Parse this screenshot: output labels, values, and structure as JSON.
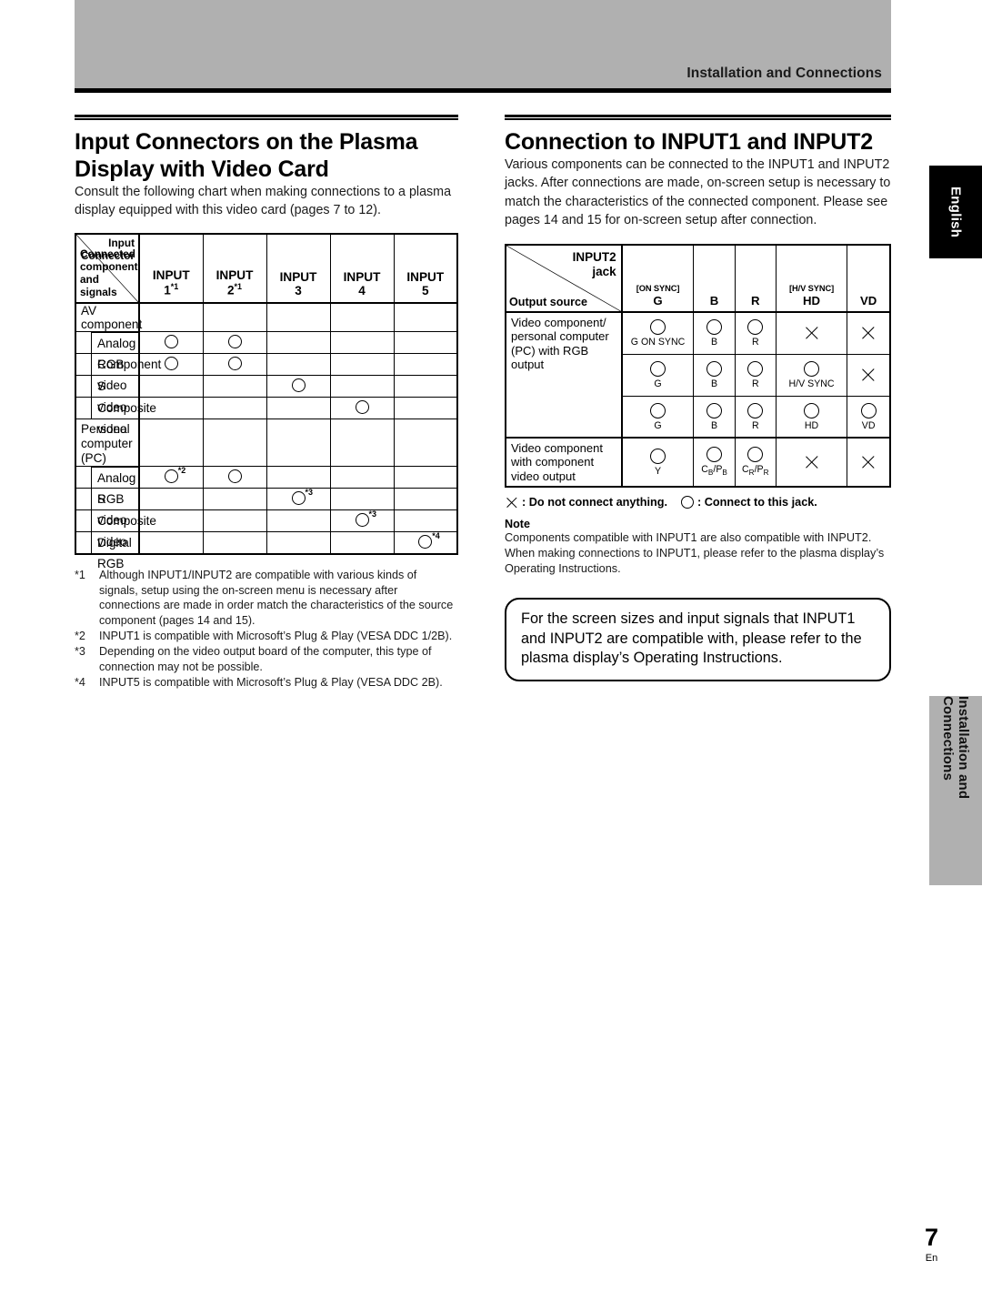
{
  "header": {
    "title": "Installation and Connections"
  },
  "left": {
    "heading": "Input Connectors on the Plasma Display with Video Card",
    "lead": "Consult the following chart when making connections to a plasma display equipped with this video card (pages 7 to 12).",
    "table": {
      "corner_top_right": "Input Connector",
      "corner_bottom_left": "Connected component and signals",
      "columns": [
        {
          "name": "INPUT",
          "num": "1",
          "note": "*1"
        },
        {
          "name": "INPUT",
          "num": "2",
          "note": "*1"
        },
        {
          "name": "INPUT",
          "num": "3",
          "note": ""
        },
        {
          "name": "INPUT",
          "num": "4",
          "note": ""
        },
        {
          "name": "INPUT",
          "num": "5",
          "note": ""
        }
      ],
      "rows": [
        {
          "label": "AV component",
          "type": "group",
          "marks": [
            "",
            "",
            "",
            "",
            ""
          ]
        },
        {
          "label": "Analog RGB",
          "type": "sub",
          "first": true,
          "marks": [
            "o",
            "o",
            "",
            "",
            ""
          ]
        },
        {
          "label": "Component video",
          "type": "sub",
          "marks": [
            "o",
            "o",
            "",
            "",
            ""
          ]
        },
        {
          "label": "S video",
          "type": "sub",
          "marks": [
            "",
            "",
            "o",
            "",
            ""
          ]
        },
        {
          "label": "Composite video",
          "type": "sub",
          "marks": [
            "",
            "",
            "",
            "o",
            ""
          ]
        },
        {
          "label": "Personal computer (PC)",
          "type": "group-tall",
          "marks": [
            "",
            "",
            "",
            "",
            ""
          ]
        },
        {
          "label": "Analog RGB",
          "type": "sub",
          "first": true,
          "marks": [
            "o*2",
            "o",
            "",
            "",
            ""
          ]
        },
        {
          "label": "S video",
          "type": "sub",
          "marks": [
            "",
            "",
            "o*3",
            "",
            ""
          ]
        },
        {
          "label": "Composite video",
          "type": "sub",
          "marks": [
            "",
            "",
            "",
            "o*3",
            ""
          ]
        },
        {
          "label": "Digital RGB",
          "type": "sub",
          "marks": [
            "",
            "",
            "",
            "",
            "o*4"
          ]
        }
      ]
    },
    "footnotes": [
      {
        "num": "*1",
        "text": "Although INPUT1/INPUT2 are compatible with various kinds of signals, setup using the on-screen menu is necessary after connections are made in order match the characteristics of the source component (pages 14 and 15)."
      },
      {
        "num": "*2",
        "text": "INPUT1 is compatible with Microsoft’s Plug & Play (VESA DDC 1/2B)."
      },
      {
        "num": "*3",
        "text": "Depending on the video output board of the computer, this type of connection may not be possible."
      },
      {
        "num": "*4",
        "text": "INPUT5 is compatible with Microsoft’s Plug & Play (VESA DDC 2B)."
      }
    ]
  },
  "right": {
    "heading": "Connection to INPUT1 and INPUT2",
    "lead": "Various components can be connected to the INPUT1 and INPUT2 jacks. After connections are made, on-screen setup is necessary to match the characteristics of the connected component. Please see pages 14 and 15 for on-screen setup after connection.",
    "table": {
      "corner_top_right": "INPUT2 jack",
      "corner_bottom_left": "Output source",
      "columns": [
        {
          "tag": "[ON SYNC]",
          "label": "G"
        },
        {
          "tag": "",
          "label": "B"
        },
        {
          "tag": "",
          "label": "R"
        },
        {
          "tag": "[H/V SYNC]",
          "label": "HD"
        },
        {
          "tag": "",
          "label": "VD"
        }
      ],
      "groups": [
        {
          "source": "Video component/ personal computer (PC) with RGB output",
          "rows": [
            [
              {
                "glyph": "o",
                "cap": "G ON SYNC"
              },
              {
                "glyph": "o",
                "cap": "B"
              },
              {
                "glyph": "o",
                "cap": "R"
              },
              {
                "glyph": "x",
                "cap": ""
              },
              {
                "glyph": "x",
                "cap": ""
              }
            ],
            [
              {
                "glyph": "o",
                "cap": "G"
              },
              {
                "glyph": "o",
                "cap": "B"
              },
              {
                "glyph": "o",
                "cap": "R"
              },
              {
                "glyph": "o",
                "cap": "H/V SYNC"
              },
              {
                "glyph": "x",
                "cap": ""
              }
            ],
            [
              {
                "glyph": "o",
                "cap": "G"
              },
              {
                "glyph": "o",
                "cap": "B"
              },
              {
                "glyph": "o",
                "cap": "R"
              },
              {
                "glyph": "o",
                "cap": "HD"
              },
              {
                "glyph": "o",
                "cap": "VD"
              }
            ]
          ]
        },
        {
          "source": "Video component with component video output",
          "rows": [
            [
              {
                "glyph": "o",
                "cap": "Y"
              },
              {
                "glyph": "o",
                "cap": "CB/PB"
              },
              {
                "glyph": "o",
                "cap": "CR/PR"
              },
              {
                "glyph": "x",
                "cap": ""
              },
              {
                "glyph": "x",
                "cap": ""
              }
            ]
          ]
        }
      ]
    },
    "legend": {
      "x_text": ": Do not connect anything.",
      "o_text": ": Connect to this jack."
    },
    "note_heading": "Note",
    "note_body": "Components compatible with INPUT1 are also compatible with INPUT2.\nWhen making connections to INPUT1, please refer to the plasma display’s Operating Instructions.",
    "callout": "For the screen sizes and input signals that INPUT1 and INPUT2 are compatible with, please refer to the plasma display’s Operating Instructions."
  },
  "side_tabs": {
    "english": "English",
    "section": "Installation and Connections"
  },
  "page": {
    "number": "7",
    "lang": "En"
  }
}
